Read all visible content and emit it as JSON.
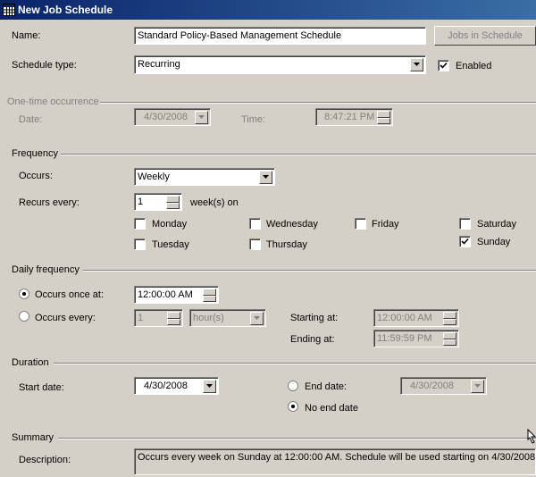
{
  "window": {
    "title": "New Job Schedule"
  },
  "general": {
    "name_label": "Name:",
    "name_value": "Standard Policy-Based Management Schedule",
    "jobs_button": "Jobs in Schedule",
    "schedule_type_label": "Schedule type:",
    "schedule_type_value": "Recurring",
    "enabled_label": "Enabled",
    "enabled_checked": true
  },
  "one_time": {
    "group_label": "One-time occurrence",
    "date_label": "Date:",
    "date_value": "4/30/2008",
    "time_label": "Time:",
    "time_value": "8:47:21 PM"
  },
  "frequency": {
    "group_label": "Frequency",
    "occurs_label": "Occurs:",
    "occurs_value": "Weekly",
    "recurs_label": "Recurs every:",
    "recurs_value": "1",
    "recurs_unit": "week(s) on",
    "days": {
      "monday": {
        "label": "Monday",
        "checked": false
      },
      "tuesday": {
        "label": "Tuesday",
        "checked": false
      },
      "wednesday": {
        "label": "Wednesday",
        "checked": false
      },
      "thursday": {
        "label": "Thursday",
        "checked": false
      },
      "friday": {
        "label": "Friday",
        "checked": false
      },
      "saturday": {
        "label": "Saturday",
        "checked": false
      },
      "sunday": {
        "label": "Sunday",
        "checked": true
      }
    }
  },
  "daily": {
    "group_label": "Daily frequency",
    "once_label": "Occurs once at:",
    "once_value": "12:00:00 AM",
    "every_label": "Occurs every:",
    "every_value": "1",
    "every_unit": "hour(s)",
    "starting_label": "Starting at:",
    "starting_value": "12:00:00 AM",
    "ending_label": "Ending at:",
    "ending_value": "11:59:59 PM"
  },
  "duration": {
    "group_label": "Duration",
    "start_label": "Start date:",
    "start_value": "4/30/2008",
    "end_label": "End date:",
    "end_value": "4/30/2008",
    "no_end_label": "No end date"
  },
  "summary": {
    "group_label": "Summary",
    "description_label": "Description:",
    "description_value": "Occurs every week on Sunday at 12:00:00 AM. Schedule will be used starting on 4/30/2008."
  }
}
